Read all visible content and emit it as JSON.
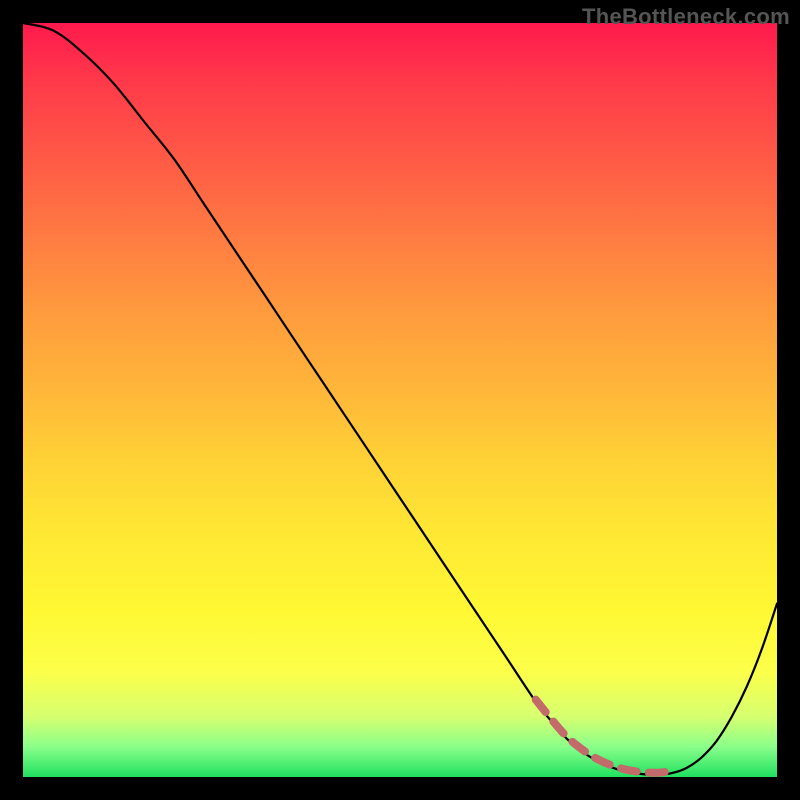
{
  "watermark": "TheBottleneck.com",
  "colors": {
    "gradient_top": "#ff1a4d",
    "gradient_mid": "#ffe834",
    "gradient_bottom": "#20e060",
    "curve_stroke": "#000000",
    "dash_stroke": "#c36a6b",
    "page_bg": "#000000"
  },
  "chart_data": {
    "type": "line",
    "title": "",
    "xlabel": "",
    "ylabel": "",
    "xlim": [
      0,
      100
    ],
    "ylim": [
      0,
      100
    ],
    "grid": false,
    "legend": false,
    "series": [
      {
        "name": "bottleneck-curve",
        "x": [
          0,
          4,
          8,
          12,
          16,
          20,
          24,
          28,
          32,
          36,
          40,
          44,
          48,
          52,
          56,
          60,
          64,
          68,
          70,
          72,
          74,
          76,
          78,
          80,
          82,
          84,
          86,
          88,
          90,
          92,
          94,
          96,
          98,
          100
        ],
        "y": [
          100,
          99,
          96,
          92,
          87,
          82,
          76,
          70,
          64,
          58,
          52,
          46,
          40,
          34,
          28,
          22,
          16,
          10,
          7.5,
          5.2,
          3.5,
          2.2,
          1.3,
          0.7,
          0.4,
          0.3,
          0.5,
          1.2,
          2.6,
          4.8,
          8,
          12,
          17,
          23
        ]
      }
    ],
    "highlight_dash_range_x": [
      68,
      86
    ],
    "annotations": []
  }
}
